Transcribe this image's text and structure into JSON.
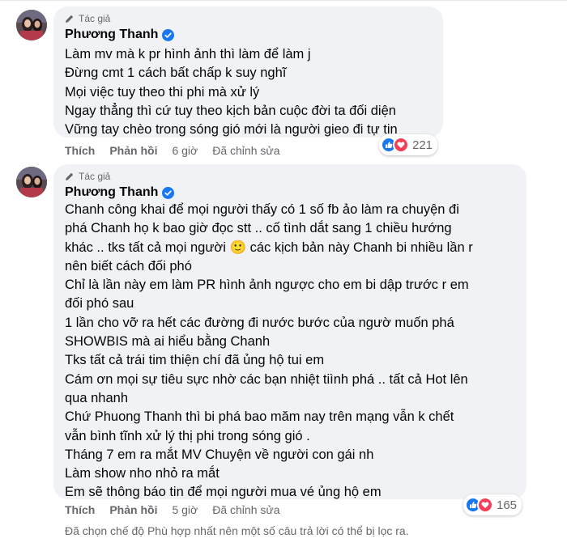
{
  "comments": [
    {
      "badge": "Tác giả",
      "author": "Phương Thanh",
      "lines": [
        "Làm mv mà k pr hình ảnh thì làm để làm j",
        "Đừng cmt 1 cách bất chấp k suy nghĩ",
        "Mọi việc tuy theo thi phi mà xử lý",
        "Ngay thẳng thì cứ tuy theo kịch bản cuộc đời ta đối diện",
        "Vững tay chèo trong sóng gió mới là người gieo đi tự tin"
      ],
      "actions": {
        "like": "Thích",
        "reply": "Phản hồi",
        "time": "6 giờ",
        "edited": "Đã chỉnh sửa"
      },
      "reaction_count": "221"
    },
    {
      "badge": "Tác giả",
      "author": "Phương Thanh",
      "lines": [
        "Chanh công khai để mọi người thấy có 1 số fb ảo làm ra chuyện đi",
        "phá Chanh họ k bao giờ đọc stt .. cố tình dắt sang 1 chiều hướng",
        "khác .. tks tất cả mọi người 🙂 các kịch bản này Chanh bi nhiều lần r",
        "nên biết cách đối phó",
        "Chỉ là lần này em làm PR hình ảnh ngược cho em bi dập trước r em",
        "đối phó sau",
        "1 lần cho vỡ ra hết các đường đi nước bước của ngườ muốn phá",
        "SHOWBIS mà ai hiểu bằng Chanh",
        "Tks tất cả trái tim thiện chí đã ủng hộ tui em",
        "Cám ơn mọi sự tiêu sực nhờ các bạn nhiệt tiình phá .. tất cả Hot lên",
        "qua nhanh",
        "Chứ Phuong Thanh thì bi phá bao măm nay trên mạng vẫn k chết",
        "vẫn bình tĩnh xử lý thị phi trong sóng gió .",
        "Tháng 7 em ra mắt MV Chuyện về người con gái nh",
        "Làm show nho nhỏ ra mắt",
        "Em sẽ thông báo tin để mọi người mua vé ủng hộ em"
      ],
      "actions": {
        "like": "Thích",
        "reply": "Phản hồi",
        "time": "5 giờ",
        "edited": "Đã chỉnh sửa"
      },
      "reaction_count": "165"
    }
  ],
  "footer_note": "Đã chọn chế độ Phù hợp nhất nên một số câu trả lời có thể bị lọc ra.",
  "colors": {
    "bubble": "#f0f2f5",
    "like_blue": "#1877f2",
    "love_red": "#f33e58",
    "muted": "#65676b"
  }
}
